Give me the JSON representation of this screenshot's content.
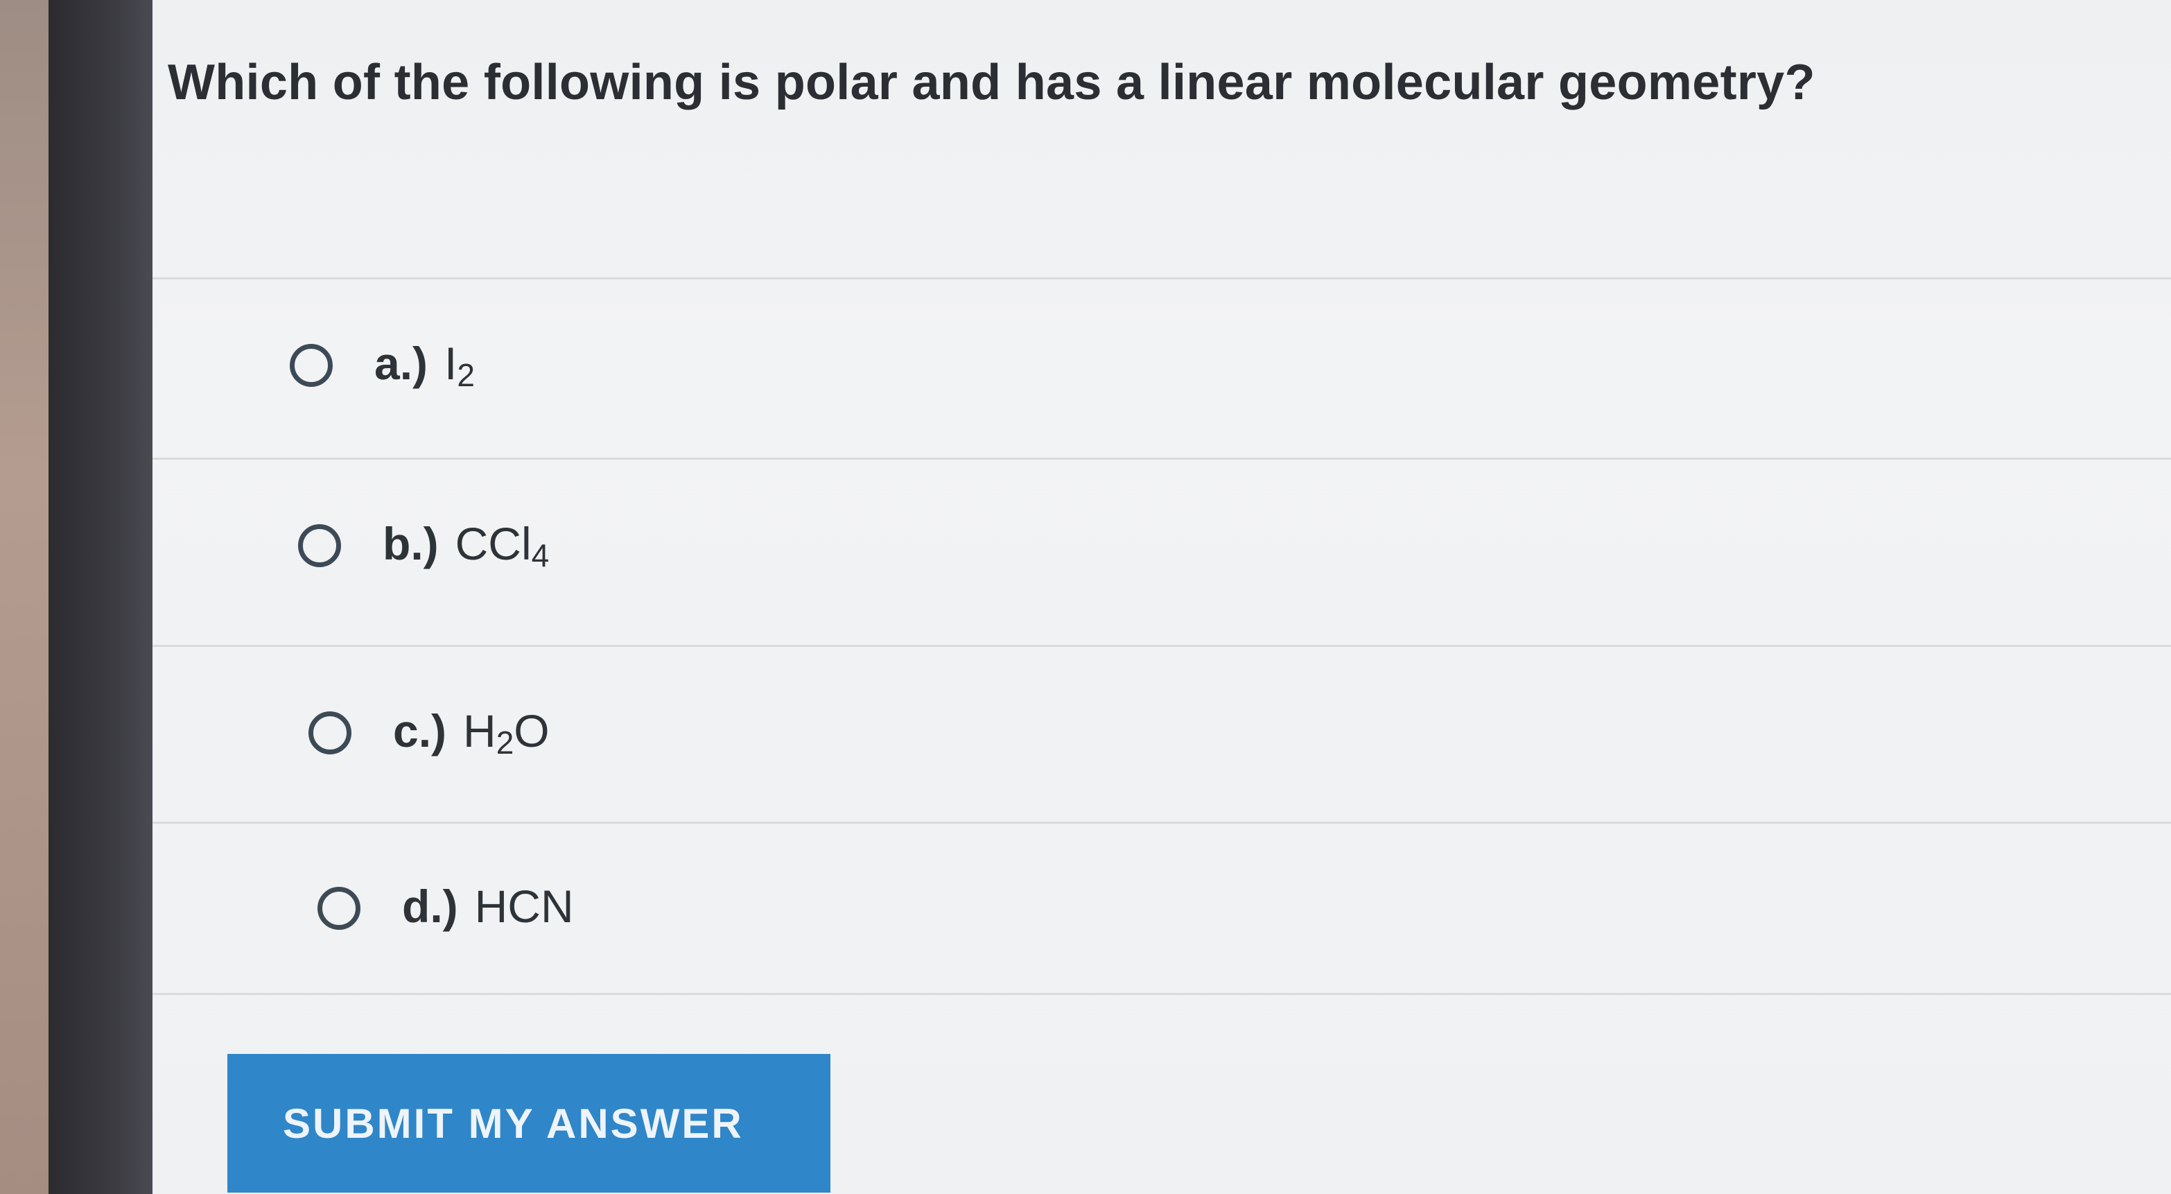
{
  "question": {
    "text": "Which of the following is polar and has a linear molecular geometry?"
  },
  "options": [
    {
      "letter": "a.)",
      "formula_parts": [
        "I",
        "2",
        ""
      ]
    },
    {
      "letter": "b.)",
      "formula_parts": [
        "CCl",
        "4",
        ""
      ]
    },
    {
      "letter": "c.)",
      "formula_parts": [
        "H",
        "2",
        "O"
      ]
    },
    {
      "letter": "d.)",
      "formula_parts": [
        "HCN",
        "",
        ""
      ]
    }
  ],
  "submit_label": "SUBMIT MY ANSWER",
  "colors": {
    "button": "#2f86c8",
    "radio_border": "#3d4a56",
    "text": "#2b2f33"
  }
}
